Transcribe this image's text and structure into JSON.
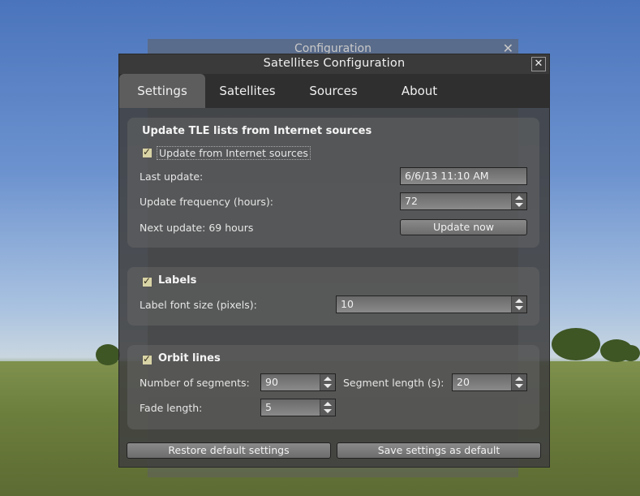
{
  "background_dialog": {
    "title": "Configuration"
  },
  "dialog": {
    "title": "Satellites Configuration",
    "close_symbol": "✕"
  },
  "tabs": [
    {
      "label": "Settings",
      "active": true
    },
    {
      "label": "Satellites",
      "active": false
    },
    {
      "label": "Sources",
      "active": false
    },
    {
      "label": "About",
      "active": false
    }
  ],
  "update_group": {
    "title": "Update TLE lists from Internet sources",
    "checkbox_label": "Update from Internet sources",
    "checked": true,
    "last_update_label": "Last update:",
    "last_update_value": "6/6/13 11:10 AM",
    "frequency_label": "Update frequency (hours):",
    "frequency_value": "72",
    "next_update_label": "Next update: 69 hours",
    "update_now_button": "Update now"
  },
  "labels_group": {
    "title": "Labels",
    "checked": true,
    "font_size_label": "Label font size (pixels):",
    "font_size_value": "10"
  },
  "orbit_group": {
    "title": "Orbit lines",
    "checked": true,
    "segments_label": "Number of  segments:",
    "segments_value": "90",
    "segment_length_label": "Segment length (s):",
    "segment_length_value": "20",
    "fade_length_label": "Fade length:",
    "fade_length_value": "5"
  },
  "footer": {
    "restore_button": "Restore default settings",
    "save_button": "Save settings as default"
  },
  "icons": {
    "close": "close-icon",
    "checkbox": "checkmark-icon",
    "spin_up": "arrow-up-icon",
    "spin_down": "arrow-down-icon",
    "cursor": "mouse-cursor-icon"
  },
  "colors": {
    "dialog_bg": "#404040",
    "checkbox_fill": "#d9d4a6",
    "sky_top": "#4a74bc"
  }
}
